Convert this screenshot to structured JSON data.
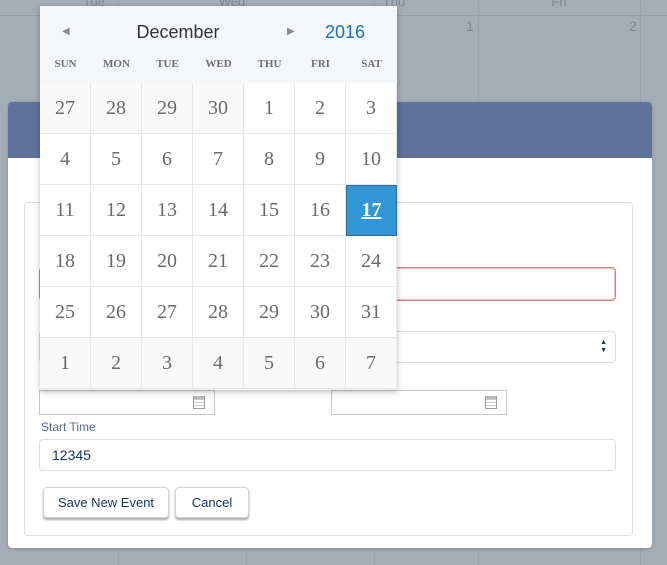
{
  "background_calendar": {
    "day_headers": [
      "Tue",
      "Wed",
      "Thu",
      "Fri"
    ],
    "day_numbers": [
      "1",
      "2"
    ]
  },
  "datepicker": {
    "prev_icon": "triangle-left-icon",
    "next_icon": "triangle-right-icon",
    "month": "December",
    "year": "2016",
    "weekdays": [
      "SUN",
      "MON",
      "TUE",
      "WED",
      "THU",
      "FRI",
      "SAT"
    ],
    "selected_day": "17",
    "weeks": [
      [
        {
          "d": "27",
          "other": true
        },
        {
          "d": "28",
          "other": true
        },
        {
          "d": "29",
          "other": true
        },
        {
          "d": "30",
          "other": true
        },
        {
          "d": "1"
        },
        {
          "d": "2"
        },
        {
          "d": "3"
        }
      ],
      [
        {
          "d": "4"
        },
        {
          "d": "5"
        },
        {
          "d": "6"
        },
        {
          "d": "7"
        },
        {
          "d": "8"
        },
        {
          "d": "9"
        },
        {
          "d": "10"
        }
      ],
      [
        {
          "d": "11"
        },
        {
          "d": "12"
        },
        {
          "d": "13"
        },
        {
          "d": "14"
        },
        {
          "d": "15"
        },
        {
          "d": "16"
        },
        {
          "d": "17",
          "selected": true
        }
      ],
      [
        {
          "d": "18"
        },
        {
          "d": "19"
        },
        {
          "d": "20"
        },
        {
          "d": "21"
        },
        {
          "d": "22"
        },
        {
          "d": "23"
        },
        {
          "d": "24"
        }
      ],
      [
        {
          "d": "25"
        },
        {
          "d": "26"
        },
        {
          "d": "27"
        },
        {
          "d": "28"
        },
        {
          "d": "29"
        },
        {
          "d": "30"
        },
        {
          "d": "31"
        }
      ],
      [
        {
          "d": "1",
          "other": true
        },
        {
          "d": "2",
          "other": true
        },
        {
          "d": "3",
          "other": true
        },
        {
          "d": "4",
          "other": true
        },
        {
          "d": "5",
          "other": true
        },
        {
          "d": "6",
          "other": true
        },
        {
          "d": "7",
          "other": true
        }
      ]
    ]
  },
  "form": {
    "title_input_value": "",
    "select_value": "",
    "start_date_value": "",
    "end_date_value": "",
    "start_time_label": "Start Time",
    "start_time_value": "12345",
    "save_label": "Save New Event",
    "cancel_label": "Cancel"
  },
  "colors": {
    "header": "#5e7199",
    "selected_day": "#3396d5",
    "year": "#1a72b5",
    "error_border": "#e37b7b"
  }
}
